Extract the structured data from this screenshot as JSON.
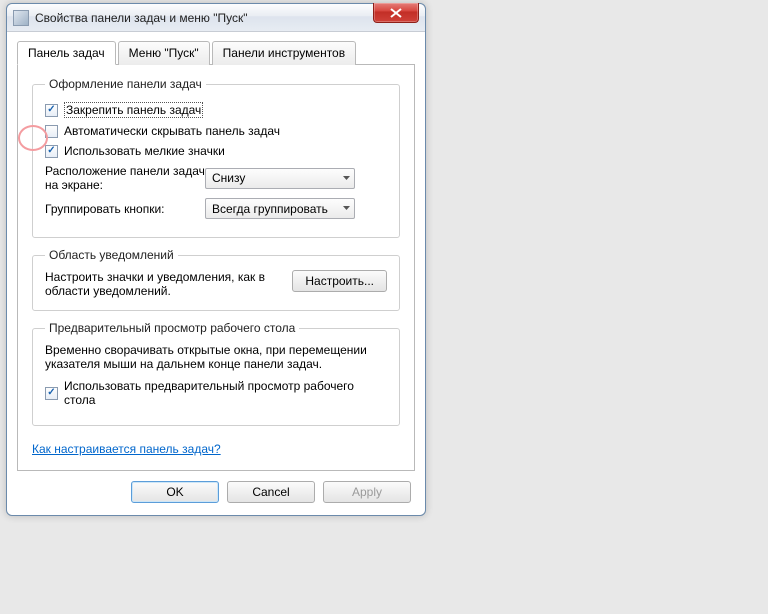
{
  "window": {
    "title": "Свойства панели задач и меню \"Пуск\""
  },
  "tabs": {
    "taskbar": "Панель задач",
    "start": "Меню \"Пуск\"",
    "toolbars": "Панели инструментов"
  },
  "group_appearance": {
    "legend": "Оформление панели задач",
    "lock": "Закрепить панель задач",
    "autohide": "Автоматически скрывать панель задач",
    "smallicons": "Использовать мелкие значки",
    "location_label": "Расположение панели задач на экране:",
    "location_value": "Снизу",
    "group_label": "Группировать кнопки:",
    "group_value": "Всегда группировать"
  },
  "group_notif": {
    "legend": "Область уведомлений",
    "text": "Настроить значки и уведомления, как в области уведомлений.",
    "button": "Настроить..."
  },
  "group_preview": {
    "legend": "Предварительный просмотр рабочего стола",
    "text": "Временно сворачивать открытые окна, при перемещении указателя мыши на дальнем конце панели задач.",
    "checkbox": "Использовать предварительный просмотр рабочего стола"
  },
  "link": "Как настраивается панель задач?",
  "buttons": {
    "ok": "OK",
    "cancel": "Cancel",
    "apply": "Apply"
  }
}
